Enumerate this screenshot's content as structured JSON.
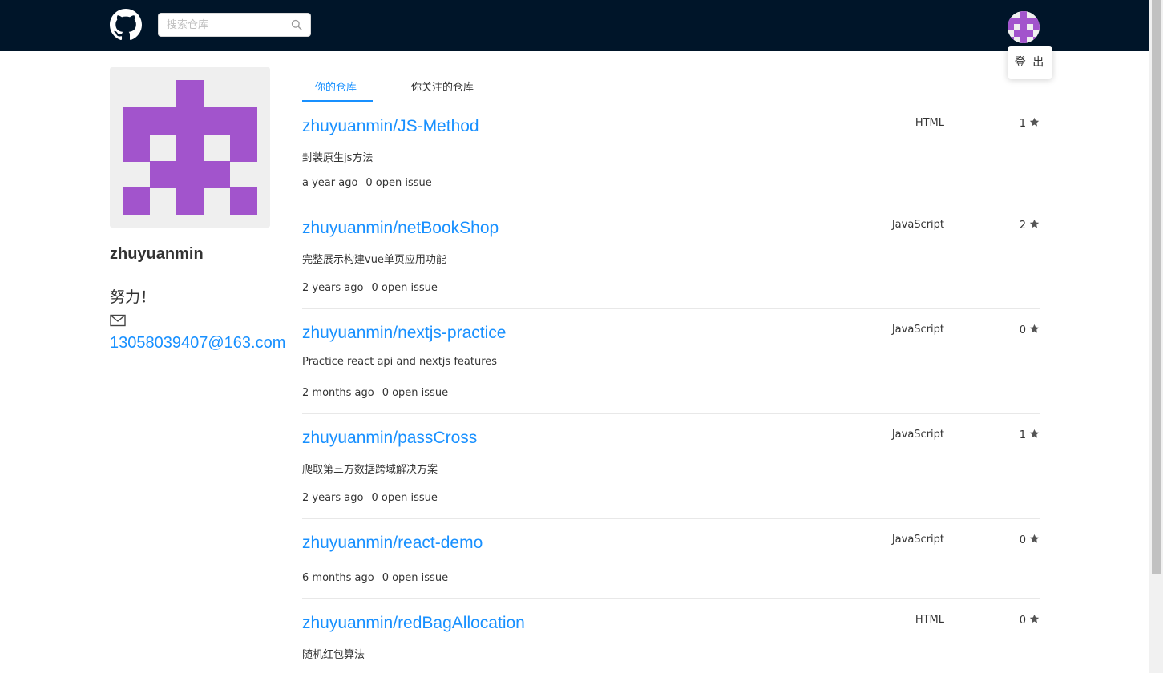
{
  "header": {
    "search_placeholder": "搜索仓库",
    "logout_label": "登 出"
  },
  "profile": {
    "login": "zhuyuanmin",
    "bio": "努力！",
    "email": "13058039407@163.com"
  },
  "tabs": [
    {
      "label": "你的仓库",
      "active": true
    },
    {
      "label": "你关注的仓库",
      "active": false
    }
  ],
  "repos": [
    {
      "name": "zhuyuanmin/JS-Method",
      "description": "封装原生js方法",
      "language": "HTML",
      "stars": "1",
      "updated": "a year ago",
      "issues": "0 open issue"
    },
    {
      "name": "zhuyuanmin/netBookShop",
      "description": "完整展示构建vue单页应用功能",
      "language": "JavaScript",
      "stars": "2",
      "updated": "2 years ago",
      "issues": "0 open issue"
    },
    {
      "name": "zhuyuanmin/nextjs-practice",
      "description": "Practice react api and nextjs features",
      "language": "JavaScript",
      "stars": "0",
      "updated": "2 months ago",
      "issues": "0 open issue"
    },
    {
      "name": "zhuyuanmin/passCross",
      "description": "爬取第三方数据跨域解决方案",
      "language": "JavaScript",
      "stars": "1",
      "updated": "2 years ago",
      "issues": "0 open issue"
    },
    {
      "name": "zhuyuanmin/react-demo",
      "description": "",
      "language": "JavaScript",
      "stars": "0",
      "updated": "6 months ago",
      "issues": "0 open issue"
    },
    {
      "name": "zhuyuanmin/redBagAllocation",
      "description": "随机红包算法",
      "language": "HTML",
      "stars": "0",
      "updated": "",
      "issues": ""
    }
  ],
  "colors": {
    "header_bg": "#001529",
    "link": "#1890ff",
    "avatar_purple": "#a254cc"
  },
  "icons": {
    "logo": "github-icon",
    "search": "search-icon",
    "mail": "mail-icon",
    "star": "star-icon"
  }
}
